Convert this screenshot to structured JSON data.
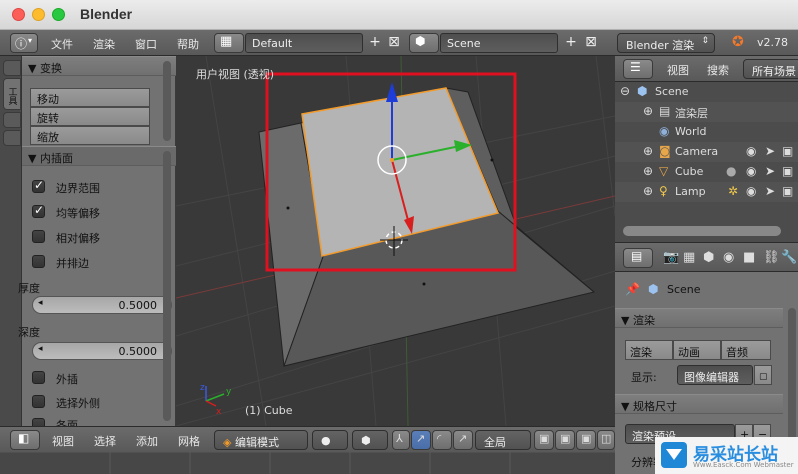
{
  "window": {
    "title": "Blender"
  },
  "topbar": {
    "menus": [
      "文件",
      "渲染",
      "窗口",
      "帮助"
    ],
    "screen_layout": "Default",
    "scene": "Scene",
    "engine": "Blender 渲染",
    "version": "v2.78"
  },
  "tool_shelf": {
    "tab_label": "工具",
    "transform": {
      "title": "▼ 变换",
      "buttons": [
        "移动",
        "旋转",
        "缩放"
      ]
    },
    "inset": {
      "title": "▼ 内插面",
      "options": [
        {
          "label": "边界范围",
          "checked": true
        },
        {
          "label": "均等偏移",
          "checked": true
        },
        {
          "label": "相对偏移",
          "checked": false
        },
        {
          "label": "并排边",
          "checked": false
        }
      ],
      "thickness_label": "厚度",
      "thickness_value": "0.5000",
      "depth_label": "深度",
      "depth_value": "0.5000",
      "options2": [
        {
          "label": "外插",
          "checked": false
        },
        {
          "label": "选择外侧",
          "checked": false
        },
        {
          "label": "各面",
          "checked": false
        }
      ]
    }
  },
  "viewport": {
    "view_label": "用户视图 (透视)",
    "object_label": "(1) Cube",
    "axis_x": "x",
    "axis_y": "y",
    "axis_z": "z",
    "highlight_color": "#e01020",
    "selection_color": "#f29b2c"
  },
  "outliner": {
    "header": {
      "view": "视图",
      "search": "搜索",
      "filter": "所有场景"
    },
    "rows": [
      {
        "name": "Scene",
        "icon": "scene-icon"
      },
      {
        "name": "渲染层",
        "icon": "render-layer-icon"
      },
      {
        "name": "World",
        "icon": "world-icon"
      },
      {
        "name": "Camera",
        "icon": "camera-icon"
      },
      {
        "name": "Cube",
        "icon": "mesh-icon"
      },
      {
        "name": "Lamp",
        "icon": "lamp-icon"
      }
    ]
  },
  "properties": {
    "context": "Scene",
    "render_panel": "▼ 渲染",
    "render_buttons": [
      "渲染",
      "动画",
      "音频"
    ],
    "display_label": "显示:",
    "display_value": "图像编辑器",
    "dimensions_panel": "▼ 规格尺寸",
    "preset": "渲染预设",
    "resolution": "分辨率"
  },
  "bottombar": {
    "menus": [
      "视图",
      "选择",
      "添加",
      "网格"
    ],
    "mode": "编辑模式",
    "orientation": "全局"
  },
  "watermark": {
    "text": "易采站长站",
    "sub": "Www.Easck.Com Webmaster"
  }
}
